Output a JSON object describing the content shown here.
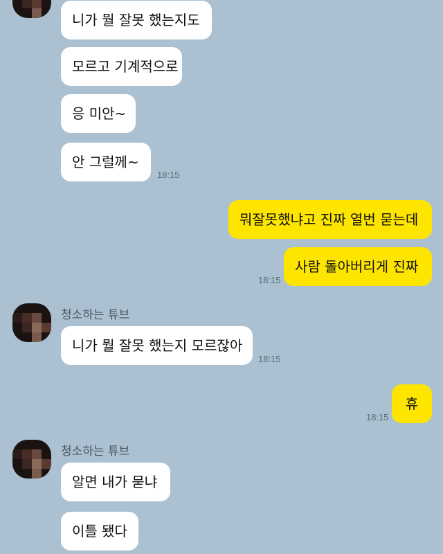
{
  "contact": {
    "name": "청소하는 튜브"
  },
  "messages": [
    {
      "side": "in",
      "text": "니가 뭘 잘못 했는지도"
    },
    {
      "side": "in",
      "text": "모르고 기계적으로"
    },
    {
      "side": "in",
      "text": "응 미안~"
    },
    {
      "side": "in",
      "text": "안 그럴께~",
      "time": "18:15"
    },
    {
      "side": "out",
      "text": "뭐잘못했냐고 진짜 열번 묻는데"
    },
    {
      "side": "out",
      "text": "사람 돌아버리게 진짜",
      "time": "18:15"
    },
    {
      "side": "in",
      "text": "니가 뭘 잘못 했는지 모르잖아",
      "time": "18:15"
    },
    {
      "side": "out",
      "text": "휴",
      "time": "18:15"
    },
    {
      "side": "in",
      "text": "알면 내가 묻냐"
    },
    {
      "side": "in",
      "text": "이틀 됐다"
    }
  ],
  "colors": {
    "background": "#abc1d1",
    "incoming": "#ffffff",
    "outgoing": "#fee500"
  }
}
